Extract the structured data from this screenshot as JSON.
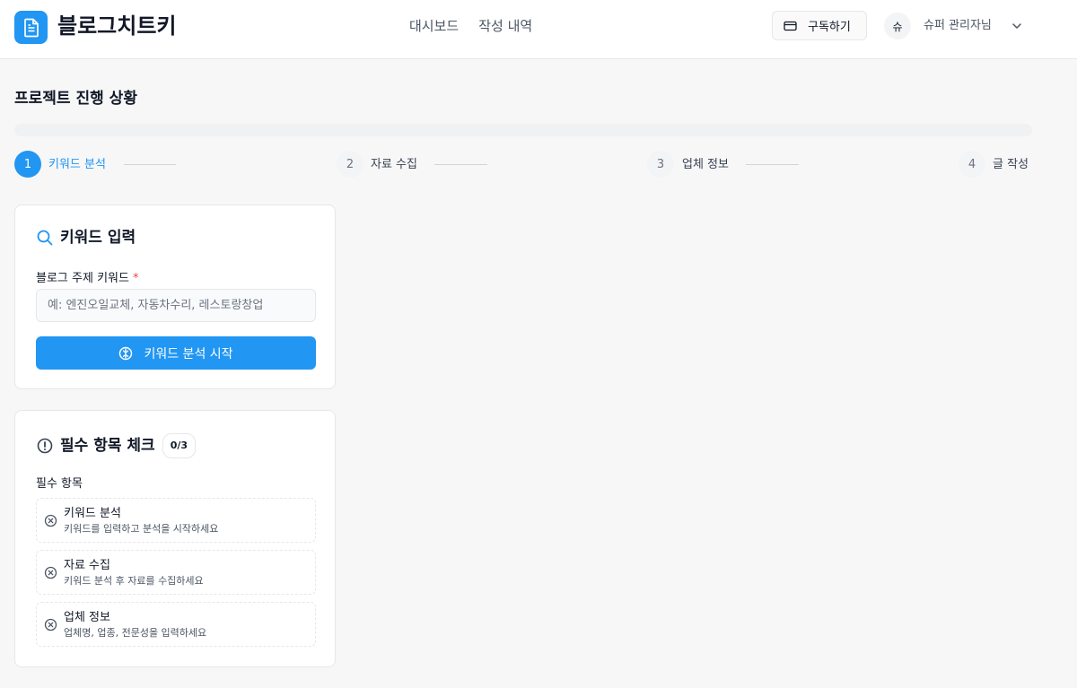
{
  "header": {
    "brand": "블로그치트키",
    "nav": [
      "대시보드",
      "작성 내역"
    ],
    "subscribe_label": "구독하기",
    "avatar_initial": "슈",
    "username": "슈퍼 관리자님"
  },
  "progress": {
    "title": "프로젝트 진행 상황",
    "fraction": 0,
    "active_color": "#2196f3",
    "steps": [
      {
        "number": "1",
        "label": "키워드 분석",
        "active": true
      },
      {
        "number": "2",
        "label": "자료 수집",
        "active": false
      },
      {
        "number": "3",
        "label": "업체 정보",
        "active": false
      },
      {
        "number": "4",
        "label": "글 작성",
        "active": false
      }
    ]
  },
  "keyword_card": {
    "title": "키워드 입력",
    "field_label": "블로그 주제 키워드",
    "required_mark": "*",
    "input_value": "",
    "placeholder": "예: 엔진오일교체, 자동차수리, 레스토랑창업",
    "button_label": "키워드 분석 시작"
  },
  "checklist_card": {
    "title": "필수 항목 체크",
    "count": "0/3",
    "subhead": "필수 항목",
    "items": [
      {
        "title": "키워드 분석",
        "desc": "키워드를 입력하고 분석을 시작하세요"
      },
      {
        "title": "자료 수집",
        "desc": "키워드 분석 후 자료를 수집하세요"
      },
      {
        "title": "업체 정보",
        "desc": "업체명, 업종, 전문성을 입력하세요"
      }
    ]
  }
}
